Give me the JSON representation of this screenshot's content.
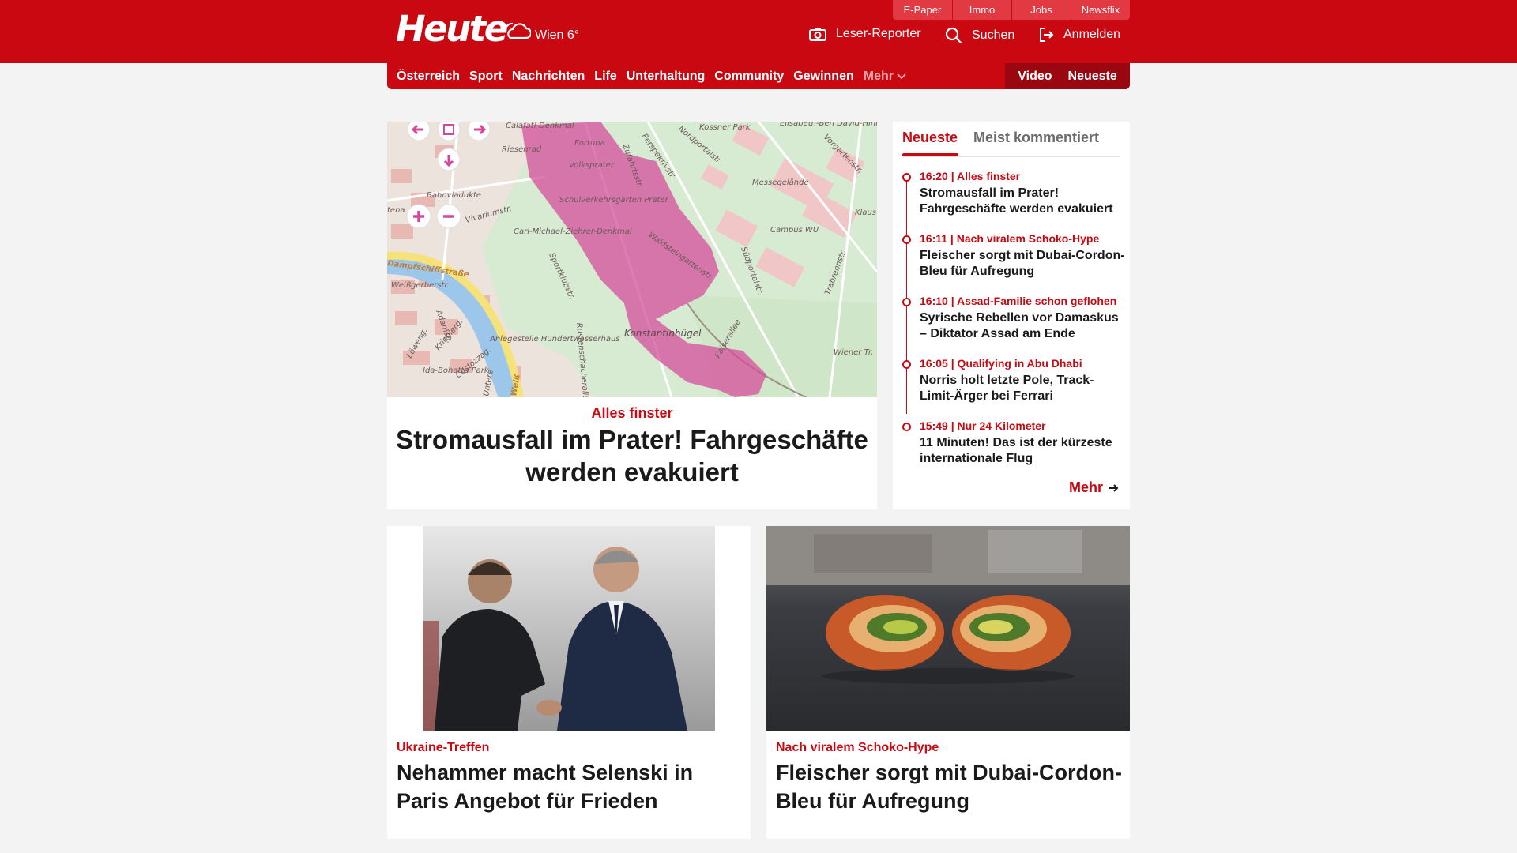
{
  "brand": {
    "logo_text": "Heute",
    "weather": "Wien 6°",
    "color": "#c90812"
  },
  "service_links": [
    "E-Paper",
    "Immo",
    "Jobs",
    "Newsflix"
  ],
  "header_actions": {
    "leser_reporter": "Leser-Reporter",
    "search": "Suchen",
    "login": "Anmelden"
  },
  "nav": {
    "items": [
      "Österreich",
      "Sport",
      "Nachrichten",
      "Life",
      "Unterhaltung",
      "Community",
      "Gewinnen"
    ],
    "more": "Mehr",
    "right": [
      "Video",
      "Neueste"
    ]
  },
  "hero": {
    "kicker": "Alles finster",
    "title": "Stromausfall im Prater! Fahrgeschäfte werden evakuiert",
    "map_labels": {
      "calafati": "Calafati-Denkmal",
      "riesenrad": "Riesenrad",
      "fortuna": "Fortuna",
      "volksprater": "Volksprater",
      "nordportal": "Nordportalstr.",
      "perspektiv": "Perspektivstr.",
      "zufahrts": "Zufahrtsstr.",
      "kossner": "Kossner Park",
      "elisabeth": "Elisabeth-Ben David-Hindler Park",
      "vorgarten": "Vorgartenstr.",
      "messe": "Messegelände",
      "bahnviadukte": "Bahnviadukte",
      "schulverkehr": "Schulverkehrsgarten Prater",
      "vivarium": "Vivariumstr.",
      "zieherer": "Carl-Michael-Ziehrer-Denkmal",
      "waldstein": "Waldsteingartenstr.",
      "campus": "Campus WU",
      "klaus": "Klaus",
      "dampfschiff": "Dampfschiffstraße",
      "weissgerber": "Weißgerberstr.",
      "sportklub": "Sportklubstr.",
      "suedportal": "Südportalstr.",
      "trabrenn": "Trabrennstr.",
      "konstantinhuegel": "Konstantinhügel",
      "anlegestelle": "Anlegestelle Hundertwasserhaus",
      "kaiserallee": "Kaiserallee",
      "rustenschacher": "Rustenschacherallee",
      "wiener_tr": "Wiener Tr.",
      "ida_bohatta": "Ida-Bohatta Park",
      "custozza": "Custozzag.",
      "kriegler": "Krieglerg.",
      "lowengasse": "Löweng.",
      "adamsg": "Adamsg.",
      "untere": "Untere",
      "weiss": "Weiß",
      "tena": "tena"
    }
  },
  "sidebar": {
    "tabs": [
      "Neueste",
      "Meist kommentiert"
    ],
    "items": [
      {
        "meta": "16:20 | Alles finster",
        "title": "Stromausfall im Prater! Fahrgeschäfte werden evakuiert"
      },
      {
        "meta": "16:11 | Nach viralem Schoko-Hype",
        "title": "Fleischer sorgt mit Dubai-Cordon-Bleu für Aufregung"
      },
      {
        "meta": "16:10 | Assad-Familie schon geflohen",
        "title": "Syrische Rebellen vor Damaskus – Diktator Assad am Ende"
      },
      {
        "meta": "16:05 | Qualifying in Abu Dhabi",
        "title": "Norris holt letzte Pole, Track-Limit-Ärger bei Ferrari"
      },
      {
        "meta": "15:49 | Nur 24 Kilometer",
        "title": "11 Minuten! Das ist der kürzeste internationale Flug"
      }
    ],
    "more": "Mehr"
  },
  "cards": [
    {
      "kicker": "Ukraine-Treffen",
      "title": "Nehammer macht Selenski in Paris Angebot für Frieden"
    },
    {
      "kicker": "Nach viralem Schoko-Hype",
      "title": "Fleischer sorgt mit Dubai-Cordon-Bleu für Aufregung"
    }
  ]
}
